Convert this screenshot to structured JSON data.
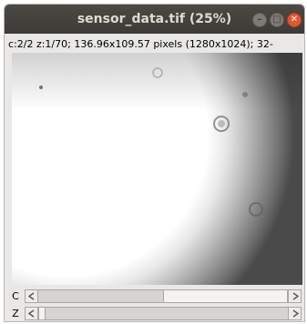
{
  "window": {
    "title": "sensor_data.tif (25%)",
    "controls": {
      "minimize_icon": "minimize-icon",
      "maximize_icon": "maximize-icon",
      "close_icon": "close-icon"
    }
  },
  "info": {
    "text": "c:2/2 z:1/70; 136.96x109.57 pixels (1280x1024); 32-"
  },
  "sliders": [
    {
      "label": "C",
      "value": 2,
      "max": 2
    },
    {
      "label": "Z",
      "value": 1,
      "max": 70
    }
  ],
  "colors": {
    "titlebar": "#3c3b37",
    "close_button": "#e9552c",
    "window_bg": "#e9e8e7"
  }
}
